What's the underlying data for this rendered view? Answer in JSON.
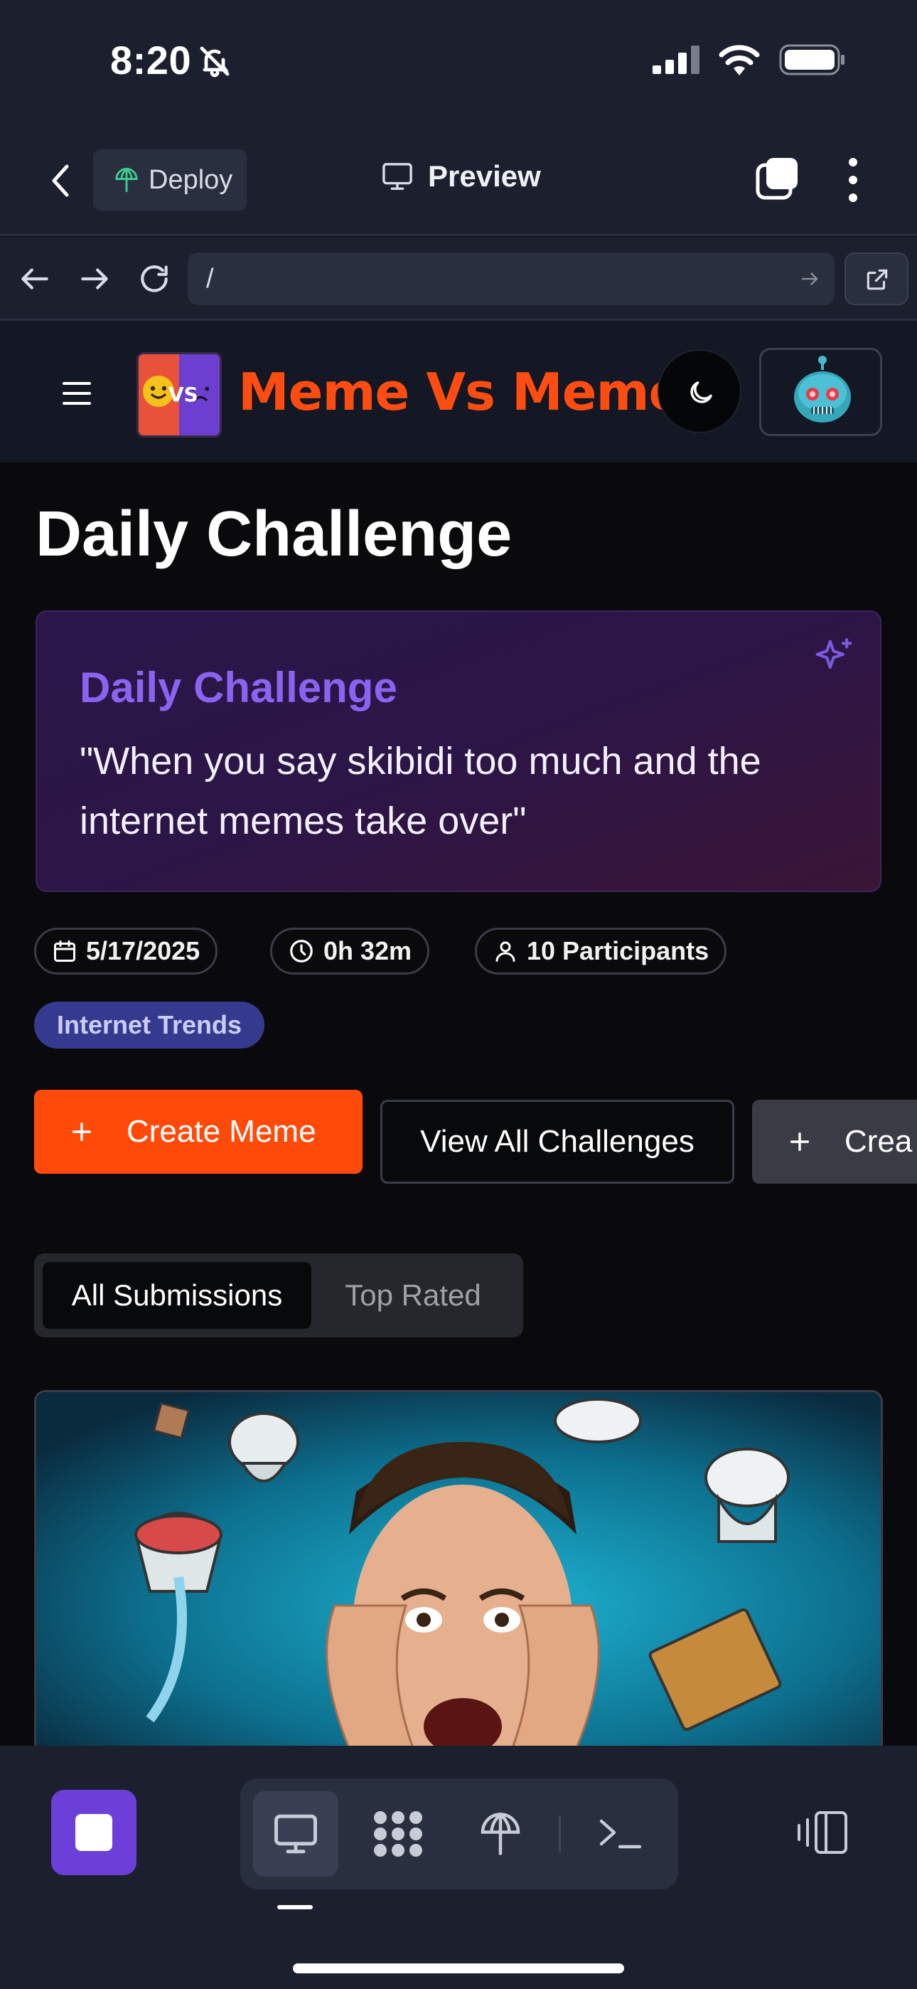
{
  "status_bar": {
    "time": "8:20"
  },
  "app_header": {
    "deploy_label": "Deploy",
    "preview_label": "Preview"
  },
  "browser": {
    "url": "/"
  },
  "site": {
    "title": "Meme Vs Meme",
    "logo_text": "VS"
  },
  "page": {
    "title": "Daily Challenge",
    "card": {
      "heading": "Daily Challenge",
      "prompt": "\"When you say skibidi too much and the internet memes take over\""
    },
    "meta": {
      "date": "5/17/2025",
      "time_left": "0h 32m",
      "participants": "10 Participants"
    },
    "tag": "Internet Trends",
    "buttons": {
      "create": "Create Meme",
      "view_all": "View All Challenges",
      "create_cut": "Crea"
    },
    "tabs": {
      "all": "All Submissions",
      "top": "Top Rated"
    }
  },
  "colors": {
    "accent": "#ff4a0a",
    "purple": "#8a63f0",
    "stop": "#6c3fd8",
    "chrome": "#1c1f2e"
  },
  "icons": [
    "bell-slash-icon",
    "signal-icon",
    "wifi-icon",
    "battery-icon",
    "chevron-left-icon",
    "deploy-icon",
    "monitor-icon",
    "tabs-icon",
    "kebab-icon",
    "arrow-left-icon",
    "arrow-right-icon",
    "reload-icon",
    "external-link-icon",
    "menu-icon",
    "moon-icon",
    "robot-avatar-icon",
    "sparkle-icon",
    "calendar-icon",
    "clock-icon",
    "user-icon",
    "plus-icon",
    "stop-icon",
    "apps-icon",
    "terminal-icon",
    "panel-icon"
  ]
}
